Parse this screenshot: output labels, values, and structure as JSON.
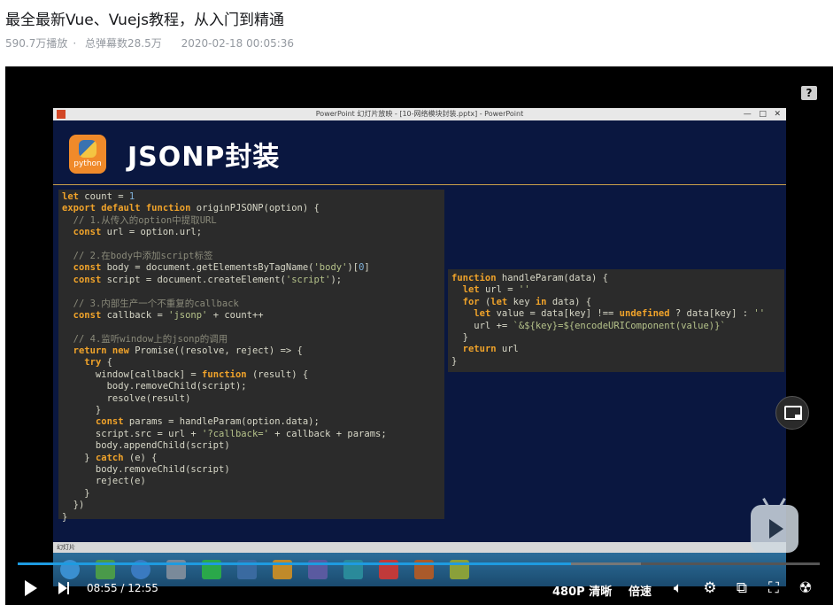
{
  "video": {
    "title": "最全最新Vue、Vuejs教程，从入门到精通",
    "plays": "590.7万播放",
    "separator": "·",
    "danmaku": "总弹幕数28.5万",
    "date": "2020-02-18 00:05:36"
  },
  "slide": {
    "window_title": "PowerPoint 幻灯片放映 - [10-网络模块封装.pptx] - PowerPoint",
    "title": "JSONP封装",
    "logo_text": "python",
    "status_text": "幻灯片",
    "code_left": [
      "let count = 1",
      "export default function originPJSONP(option) {",
      "  // 1.从传入的option中提取URL",
      "  const url = option.url;",
      "",
      "  // 2.在body中添加script标签",
      "  const body = document.getElementsByTagName('body')[0]",
      "  const script = document.createElement('script');",
      "",
      "  // 3.内部生产一个不重复的callback",
      "  const callback = 'jsonp' + count++",
      "",
      "  // 4.监听window上的jsonp的调用",
      "  return new Promise((resolve, reject) => {",
      "    try {",
      "      window[callback] = function (result) {",
      "        body.removeChild(script);",
      "        resolve(result)",
      "      }",
      "      const params = handleParam(option.data);",
      "      script.src = url + '?callback=' + callback + params;",
      "      body.appendChild(script)",
      "    } catch (e) {",
      "      body.removeChild(script)",
      "      reject(e)",
      "    }",
      "  })",
      "}"
    ],
    "code_right": [
      "function handleParam(data) {",
      "  let url = ''",
      "  for (let key in data) {",
      "    let value = data[key] !== undefined ? data[key] : ''",
      "    url += `&${key}=${encodeURIComponent(value)}`",
      "  }",
      "  return url",
      "}"
    ]
  },
  "player": {
    "current_time": "08:55",
    "time_separator": "/",
    "duration": "12:55",
    "progress_fraction": 0.69,
    "quality": "480P 清晰",
    "speed": "倍速",
    "help_icon": "?",
    "accent_color": "#1e9be0"
  }
}
